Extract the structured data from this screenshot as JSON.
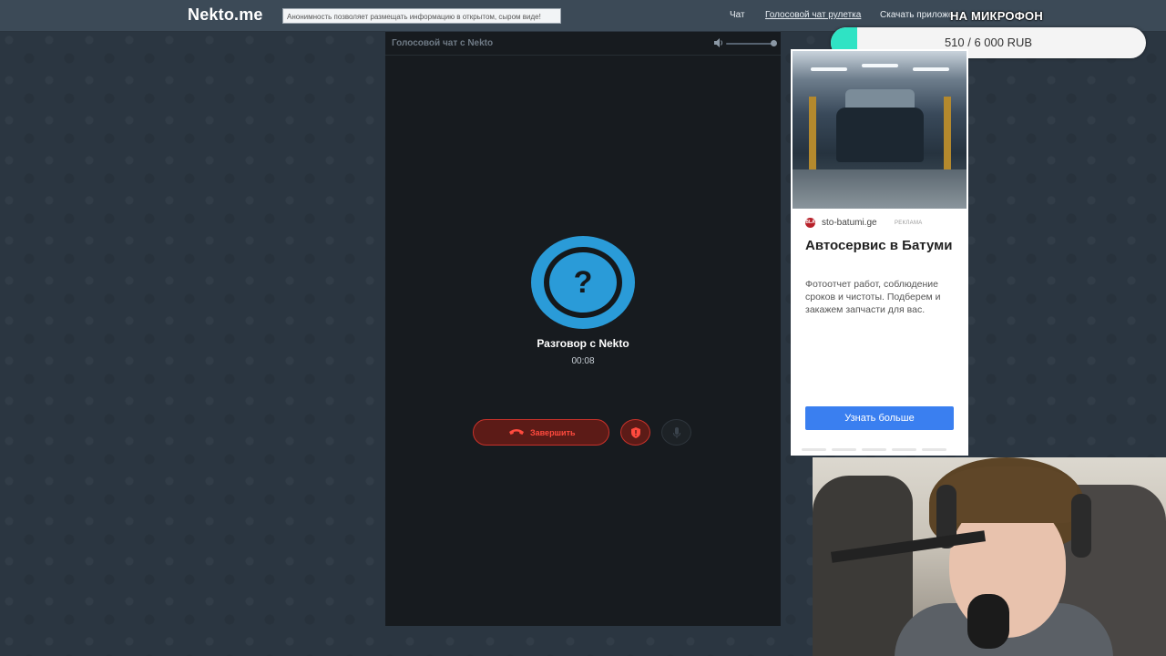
{
  "header": {
    "logo": "Nekto.me",
    "marquee_text": "Анонимность позволяет размещать информацию в открытом, сыром виде!",
    "nav": {
      "chat": "Чат",
      "voice_roulette": "Голосовой чат рулетка",
      "download_app": "Скачать приложение"
    }
  },
  "donation_widget": {
    "title": "НА МИКРОФОН",
    "progress_text": "510 / 6 000 RUB",
    "raised": 510,
    "goal": 6000,
    "fill_color": "#2fe3c4"
  },
  "voice_panel": {
    "title": "Голосовой чат с Nekto",
    "volume_icon": "speaker-icon",
    "avatar_symbol": "?",
    "avatar_color": "#2a9bd8",
    "peer_name": "Разговор с Nekto",
    "timer": "00:08",
    "end_button_label": "Завершить",
    "end_icon": "phone-hangup-icon",
    "report_icon": "shield-icon",
    "mic_icon": "microphone-icon",
    "accent_color": "#c8322a"
  },
  "ad": {
    "favicon_text": "BLA",
    "domain": "sto-batumi.ge",
    "label": "РЕКЛАМА",
    "title": "Автосервис в Батуми",
    "text": "Фотоотчет работ, соблюдение сроков и чистоты. Подберем и закажем запчасти для вас.",
    "button": "Узнать больше",
    "button_color": "#3a7ff0"
  }
}
